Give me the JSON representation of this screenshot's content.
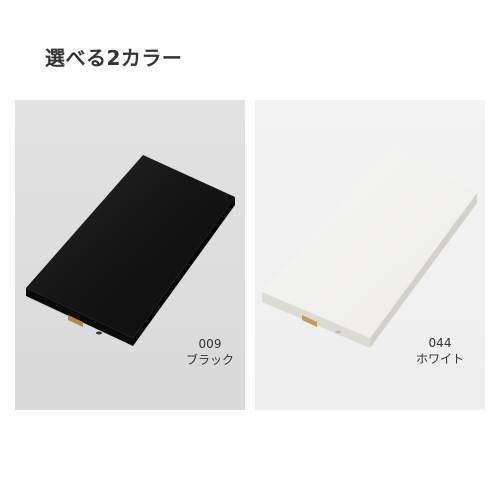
{
  "heading": "選べる2カラー",
  "colors": [
    {
      "code": "009",
      "name": "ブラック",
      "swatch": "#1a1a1a"
    },
    {
      "code": "044",
      "name": "ホワイト",
      "swatch": "#f2f1ee"
    }
  ]
}
